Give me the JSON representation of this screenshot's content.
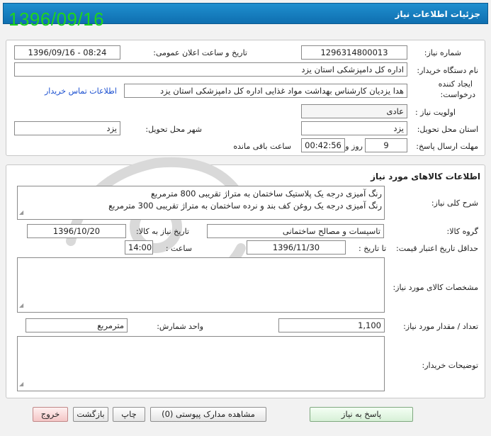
{
  "header": {
    "title": "جزئیات اطلاعات نیاز",
    "overlay_date": "1396/09/16"
  },
  "need_info": {
    "need_number_label": "شماره نیاز:",
    "need_number": "1296314800013",
    "announce_label": "تاریخ و ساعت اعلان عمومی:",
    "announce_value": "1396/09/16 - 08:24",
    "buyer_org_label": "نام دستگاه خریدار:",
    "buyer_org": "اداره کل دامپزشکی استان یزد",
    "creator_label_1": "ایجاد کننده",
    "creator_label_2": "درخواست:",
    "creator": "هدا یزدیان کارشناس بهداشت مواد غذایی اداره کل دامپزشکی استان یزد",
    "contact_link": "اطلاعات تماس خریدار",
    "priority_label": "اولویت نیاز :",
    "priority": "عادی",
    "province_label": "استان محل تحویل:",
    "province": "یزد",
    "city_label": "شهر محل تحویل:",
    "city": "یزد",
    "deadline_label": "مهلت ارسال پاسخ:",
    "deadline_days": "9",
    "days_word": "روز و",
    "deadline_time": "00:42:56",
    "remaining_word": "ساعت باقی مانده"
  },
  "goods": {
    "section_title": "اطلاعات کالاهای مورد نیاز",
    "summary_label": "شرح کلی نیاز:",
    "summary_line1": "رنگ آمیزی درجه یک پلاستیک ساختمان به متراژ تقریبی 800 مترمربع",
    "summary_line2": "رنگ آمیزی درجه یک روغن کف بند و نرده ساختمان به متراژ تقریبی 300 مترمربع",
    "group_label": "گروه کالا:",
    "group": "تاسیسات و مصالح ساختمانی",
    "need_date_label": "تاریخ نیاز به کالا:",
    "need_date": "1396/10/20",
    "validity_label": "حداقل تاریخ اعتبار قیمت:",
    "until_date_label": "تا تاریخ :",
    "until_date": "1396/11/30",
    "time_label": "ساعت :",
    "time": "14:00",
    "specs_label": "مشخصات کالای مورد نیاز:",
    "quantity_label": "تعداد / مقدار مورد نیاز:",
    "quantity": "1,100",
    "unit_label": "واحد شمارش:",
    "unit": "مترمربع",
    "buyer_notes_label": "توضیحات خریدار:"
  },
  "buttons": {
    "reply": "پاسخ به نیاز",
    "attachments": "مشاهده مدارک پیوستی (0)",
    "print": "چاپ",
    "back": "بازگشت",
    "exit": "خروج"
  },
  "colors": {
    "header_blue": "#1473b8",
    "overlay_green": "#1fd31f",
    "link_blue": "#1a4fd0"
  }
}
